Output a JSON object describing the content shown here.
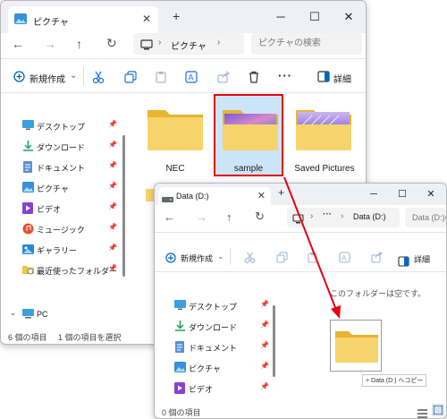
{
  "window1": {
    "tab_title": "ピクチャ",
    "path": [
      "ピクチャ"
    ],
    "search_placeholder": "ピクチャの検索",
    "toolbar": {
      "new_label": "新規作成",
      "details_label": "詳細"
    },
    "sidebar": [
      {
        "label": "デスクトップ",
        "icon": "desktop-icon"
      },
      {
        "label": "ダウンロード",
        "icon": "download-icon"
      },
      {
        "label": "ドキュメント",
        "icon": "document-icon"
      },
      {
        "label": "ピクチャ",
        "icon": "pictures-icon"
      },
      {
        "label": "ビデオ",
        "icon": "videos-icon"
      },
      {
        "label": "ミュージック",
        "icon": "music-icon"
      },
      {
        "label": "ギャラリー",
        "icon": "gallery-icon"
      },
      {
        "label": "最近使ったフォルダー",
        "icon": "recent-folder-icon"
      }
    ],
    "pc_label": "PC",
    "folders": [
      {
        "name": "NEC"
      },
      {
        "name": "sample"
      },
      {
        "name": "Saved Pictures"
      }
    ],
    "status": {
      "count": "6 個の項目",
      "selected": "1 個の項目を選択"
    }
  },
  "window2": {
    "tab_title": "Data (D:)",
    "path": [
      "Data (D:)"
    ],
    "search_placeholder": "Data (D:)の",
    "toolbar": {
      "new_label": "新規作成",
      "details_label": "詳細"
    },
    "sidebar": [
      {
        "label": "デスクトップ",
        "icon": "desktop-icon"
      },
      {
        "label": "ダウンロード",
        "icon": "download-icon"
      },
      {
        "label": "ドキュメント",
        "icon": "document-icon"
      },
      {
        "label": "ピクチャ",
        "icon": "pictures-icon"
      },
      {
        "label": "ビデオ",
        "icon": "videos-icon"
      }
    ],
    "empty_message": "このフォルダーは空です。",
    "drag_tooltip": "+ Data (D:) へコピー",
    "status": {
      "count": "0 個の項目"
    }
  },
  "colors": {
    "highlight": "#e60012",
    "folder": "#f7c948",
    "accent": "#0067c0"
  }
}
